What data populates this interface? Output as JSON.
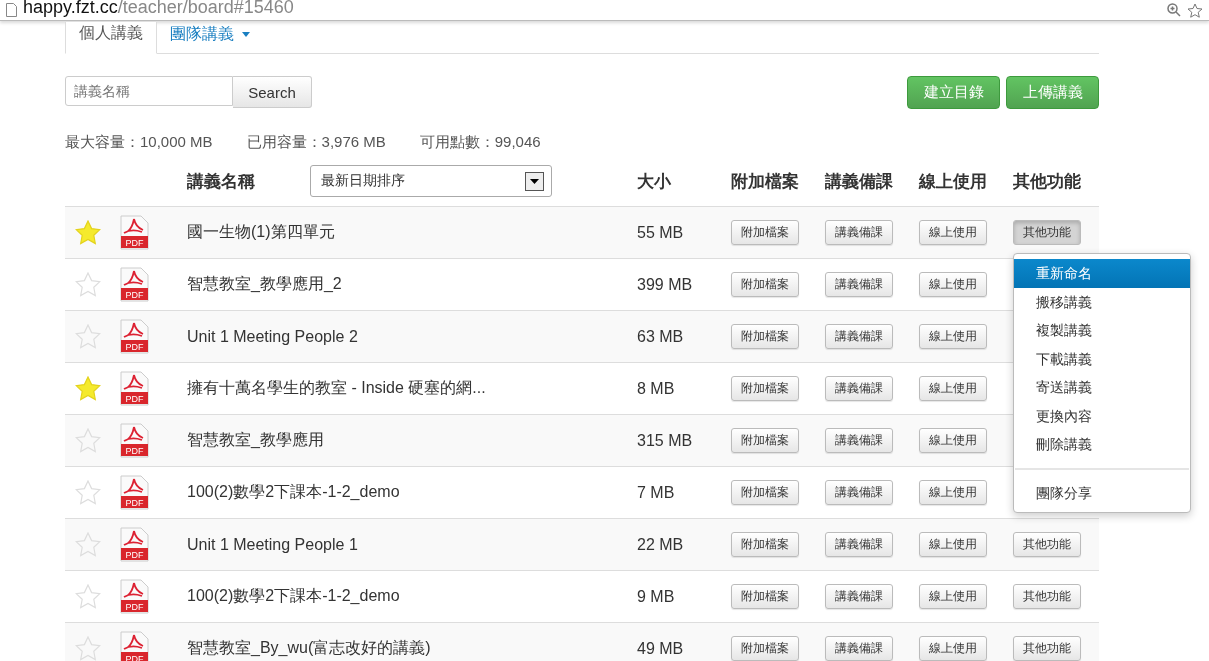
{
  "address_bar": {
    "host": "happy.fzt.cc",
    "path": "/teacher/board#15460"
  },
  "tabs": [
    {
      "label": "個人講義",
      "selected": true,
      "dropdown": false
    },
    {
      "label": "團隊講義",
      "selected": false,
      "dropdown": true
    }
  ],
  "search": {
    "placeholder": "講義名稱",
    "button": "Search"
  },
  "actions": [
    "建立目錄",
    "上傳講義"
  ],
  "stats": [
    "最大容量：10,000 MB",
    "已用容量：3,976 MB",
    "可用點數：99,046"
  ],
  "table": {
    "columns": [
      "講義名稱",
      "大小",
      "附加檔案",
      "講義備課",
      "線上使用",
      "其他功能"
    ],
    "sort": "最新日期排序",
    "rows": [
      {
        "starred": true,
        "file_type": "PDF",
        "name": "國一生物(1)第四單元",
        "size": "55 MB",
        "buttons": [
          "附加檔案",
          "講義備課",
          "線上使用"
        ],
        "other": {
          "label": "其他功能",
          "open": true
        }
      },
      {
        "starred": false,
        "file_type": "PDF",
        "name": "智慧教室_教學應用_2",
        "size": "399 MB",
        "buttons": [
          "附加檔案",
          "講義備課",
          "線上使用"
        ]
      },
      {
        "starred": false,
        "file_type": "PDF",
        "name": "Unit 1 Meeting People 2",
        "size": "63 MB",
        "buttons": [
          "附加檔案",
          "講義備課",
          "線上使用"
        ]
      },
      {
        "starred": true,
        "file_type": "PDF",
        "name": "擁有十萬名學生的教室 - Inside 硬塞的網...",
        "size": "8 MB",
        "buttons": [
          "附加檔案",
          "講義備課",
          "線上使用"
        ]
      },
      {
        "starred": false,
        "file_type": "PDF",
        "name": "智慧教室_教學應用",
        "size": "315 MB",
        "buttons": [
          "附加檔案",
          "講義備課",
          "線上使用"
        ]
      },
      {
        "starred": false,
        "file_type": "PDF",
        "name": "100(2)數學2下課本-1-2_demo",
        "size": "7 MB",
        "buttons": [
          "附加檔案",
          "講義備課",
          "線上使用"
        ]
      },
      {
        "starred": false,
        "file_type": "PDF",
        "name": "Unit 1 Meeting People 1",
        "size": "22 MB",
        "buttons": [
          "附加檔案",
          "講義備課",
          "線上使用"
        ],
        "other": {
          "label": "其他功能",
          "open": false
        }
      },
      {
        "starred": false,
        "file_type": "PDF",
        "name": "100(2)數學2下課本-1-2_demo",
        "size": "9 MB",
        "buttons": [
          "附加檔案",
          "講義備課",
          "線上使用"
        ],
        "other": {
          "label": "其他功能",
          "open": false
        }
      },
      {
        "starred": false,
        "file_type": "PDF",
        "name": "智慧教室_By_wu(富志改好的講義)",
        "size": "49 MB",
        "buttons": [
          "附加檔案",
          "講義備課",
          "線上使用"
        ],
        "other": {
          "label": "其他功能",
          "open": false
        }
      }
    ]
  },
  "menu": {
    "sections": [
      [
        {
          "label": "重新命名",
          "selected": true
        },
        {
          "label": "搬移講義",
          "selected": false
        },
        {
          "label": "複製講義",
          "selected": false
        },
        {
          "label": "下載講義",
          "selected": false
        },
        {
          "label": "寄送講義",
          "selected": false
        },
        {
          "label": "更換內容",
          "selected": false
        },
        {
          "label": "刪除講義",
          "selected": false
        }
      ],
      [
        {
          "label": "團隊分享",
          "selected": false
        }
      ]
    ]
  }
}
